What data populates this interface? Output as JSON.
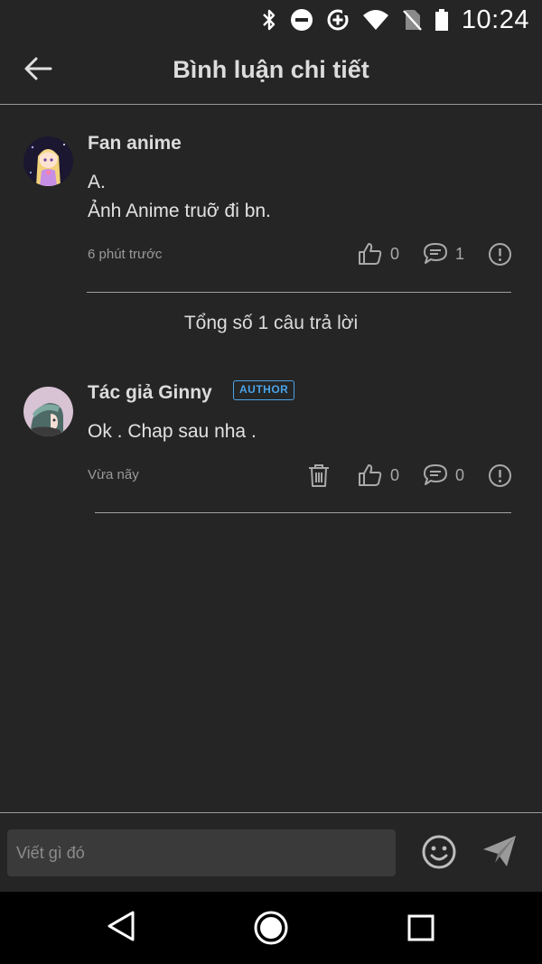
{
  "status_bar": {
    "time": "10:24",
    "icons": [
      "bluetooth-icon",
      "do-not-disturb-icon",
      "data-saver-icon",
      "wifi-icon",
      "no-sim-icon",
      "battery-icon"
    ]
  },
  "header": {
    "title": "Bình luận chi tiết",
    "back_icon": "arrow-left-icon"
  },
  "main_comment": {
    "author": "Fan anime",
    "text_lines": [
      "A.",
      "Ảnh Anime truỡ đi bn."
    ],
    "time": "6 phút trước",
    "likes": "0",
    "replies": "1"
  },
  "reply_summary": "Tổng số 1 câu trả lời",
  "reply": {
    "author": "Tác giả Ginny",
    "badge": "AUTHOR",
    "text": "Ok . Chap sau nha .",
    "time": "Vừa nãy",
    "likes": "0",
    "replies": "0"
  },
  "input_bar": {
    "placeholder": "Viết gì đó"
  },
  "colors": {
    "background": "#252525",
    "badge": "#4aa3e8",
    "muted": "#9a9a9a"
  }
}
